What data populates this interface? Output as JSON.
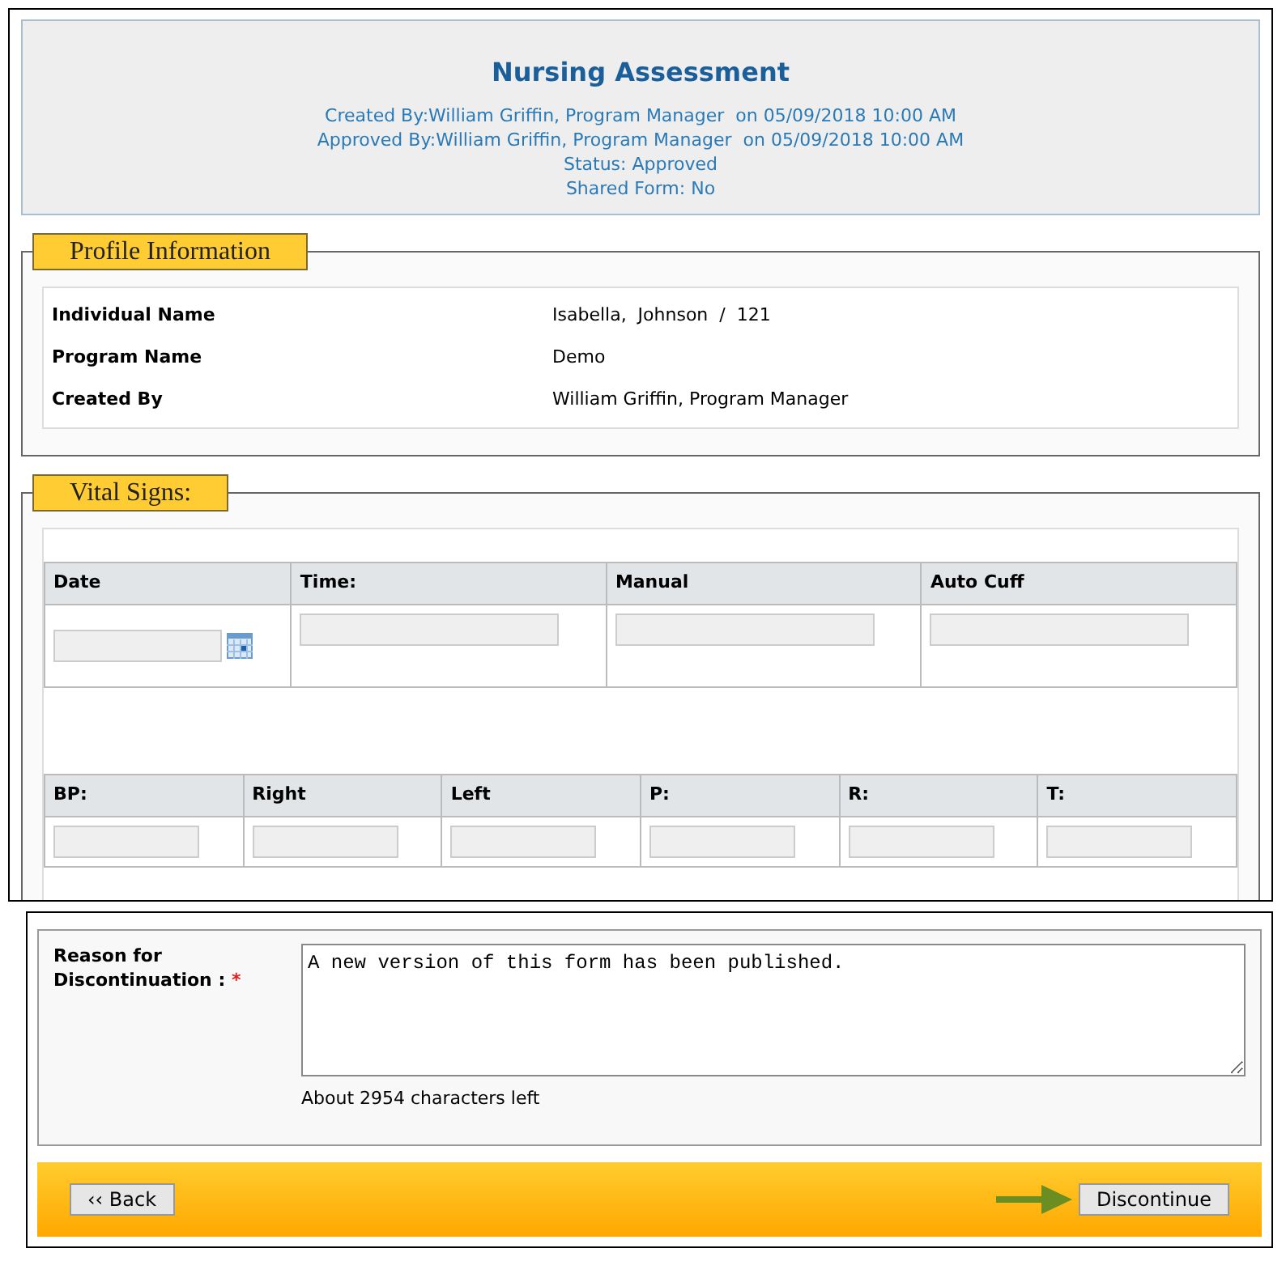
{
  "header": {
    "title": "Nursing Assessment",
    "lines": [
      "Created By:William Griffin, Program Manager  on 05/09/2018 10:00 AM",
      "Approved By:William Griffin, Program Manager  on 05/09/2018 10:00 AM",
      "Status: Approved",
      "Shared Form: No"
    ]
  },
  "profile": {
    "legend": "Profile Information",
    "rows": [
      {
        "label": "Individual Name",
        "value": "Isabella,  Johnson  /  121"
      },
      {
        "label": "Program Name",
        "value": "Demo"
      },
      {
        "label": "Created By",
        "value": "William Griffin, Program Manager"
      }
    ]
  },
  "vitals": {
    "legend": "Vital Signs:",
    "tables": [
      {
        "columns": [
          {
            "label": "Date",
            "kind": "date"
          },
          {
            "label": "Time:",
            "kind": "text"
          },
          {
            "label": "Manual",
            "kind": "text"
          },
          {
            "label": "Auto Cuff",
            "kind": "text"
          }
        ]
      },
      {
        "columns": [
          {
            "label": "BP:",
            "kind": "text"
          },
          {
            "label": "Right",
            "kind": "text"
          },
          {
            "label": "Left",
            "kind": "text"
          },
          {
            "label": "P:",
            "kind": "text"
          },
          {
            "label": "R:",
            "kind": "text"
          },
          {
            "label": "T:",
            "kind": "text"
          }
        ]
      }
    ]
  },
  "discontinue": {
    "label": "Reason for Discontinuation :",
    "required": true,
    "required_mark": "*",
    "value": "A new version of this form has been published.",
    "counter": "About 2954 characters left"
  },
  "buttons": [
    {
      "label": "‹‹ Back",
      "pointer_arrow": false
    },
    {
      "label": "Discontinue",
      "pointer_arrow": true
    }
  ]
}
